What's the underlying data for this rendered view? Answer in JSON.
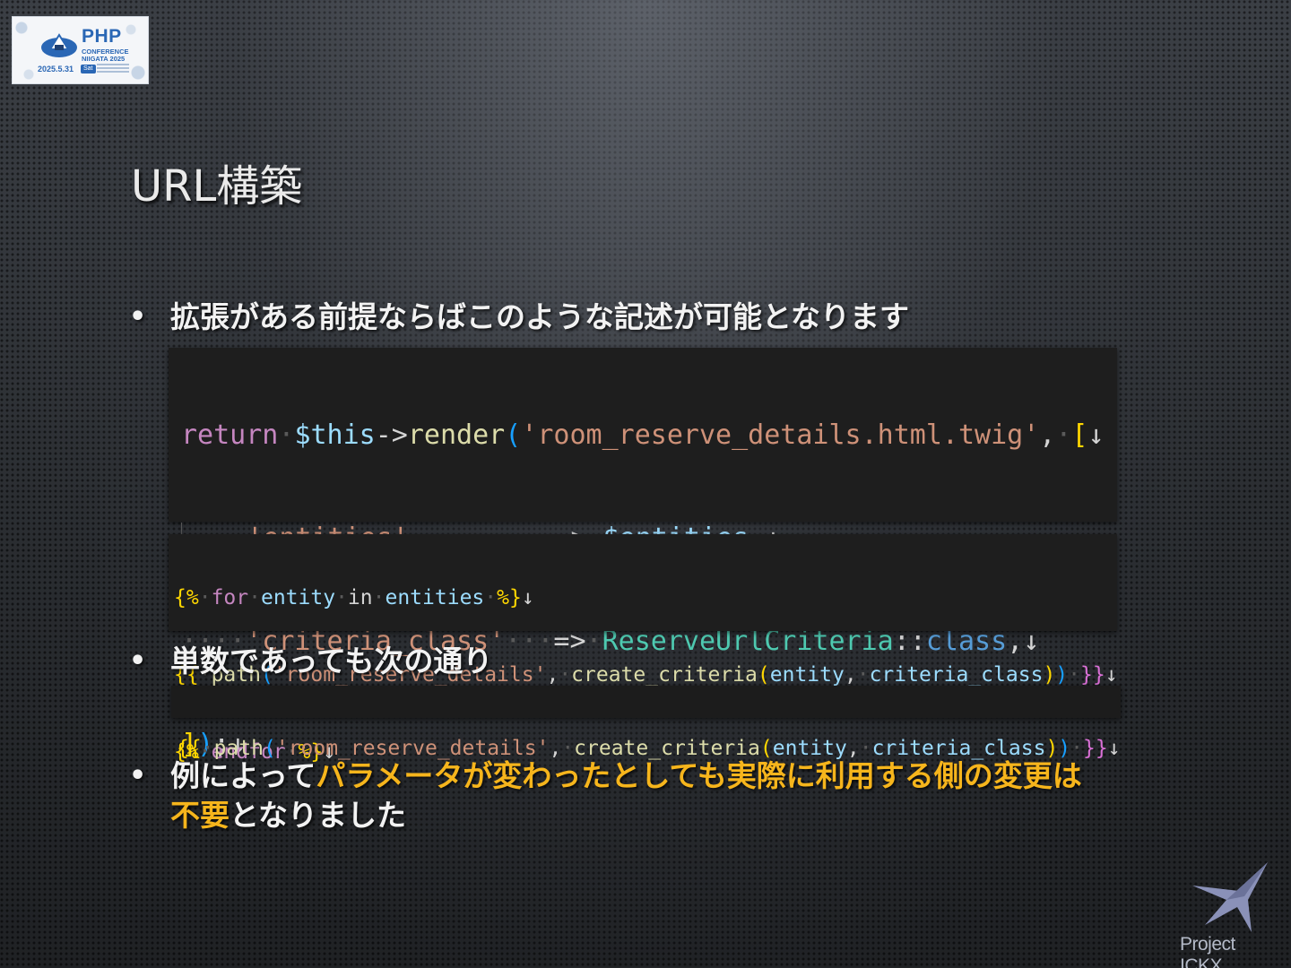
{
  "logo": {
    "name": "PHP",
    "subtitle_lines": [
      "CONFERENCE",
      "NIIGATA 2025"
    ],
    "date": "2025.5.31",
    "day": "Sat"
  },
  "slide": {
    "title": "URL構築",
    "bullets": [
      {
        "text": "拡張がある前提ならばこのような記述が可能となります"
      },
      {
        "text": "単数であっても次の通り"
      },
      {
        "plain_before": "例によって",
        "highlight_line1": "パラメータが変わったとしても実際に利用する側の変更は",
        "highlight_line2": "不要",
        "plain_after": "となりました"
      }
    ]
  },
  "code_php": {
    "l1": {
      "kw": "return",
      "var": "$this",
      "arrow": "->",
      "fn": "render",
      "p_open": "(",
      "str": "'room_reserve_details.html.twig'",
      "comma": ",",
      "b_open": "[",
      "eol": "↓"
    },
    "l2": {
      "dots1": "····",
      "key": "'entities'",
      "dots2": "·········",
      "op": "=>",
      "val": "$entities",
      "comma": ",",
      "eol": "↓"
    },
    "l3": {
      "dots1": "····",
      "key": "'criteria_class'",
      "dots2": "···",
      "op": "=>",
      "cls": "ReserveUrlCriteria",
      "dc": "::",
      "ckw": "class",
      "comma": ",",
      "eol": "↓"
    },
    "l4": {
      "b_close": "]",
      "p_close": ")",
      "semi": ";",
      "eol": "↓"
    }
  },
  "code_twig": {
    "l1": {
      "open": "{%",
      "kw_for": "for",
      "entity": "entity",
      "kw_in": "in",
      "entities": "entities",
      "close": "%}",
      "eol": "↓"
    },
    "l2": {
      "open": "{{",
      "fn": "path",
      "p1": "(",
      "str": "'room_reserve_details'",
      "comma1": ",",
      "fn2": "create_criteria",
      "p2": "(",
      "arg1": "entity",
      "comma2": ",",
      "arg2": "criteria_class",
      "p2c": ")",
      "p1c": ")",
      "close": "}}",
      "eol": "↓"
    },
    "l3": {
      "open": "{%",
      "kw": "endfor",
      "close": "%}",
      "eol": "↓"
    }
  },
  "code_single": {
    "l1": {
      "open": "{{",
      "fn": "path",
      "p1": "(",
      "str": "'room_reserve_details'",
      "comma1": ",",
      "fn2": "create_criteria",
      "p2": "(",
      "arg1": "entity",
      "comma2": ",",
      "arg2": "criteria_class",
      "p2c": ")",
      "p1c": ")",
      "close": "}}",
      "eol": "↓"
    }
  },
  "brand": {
    "name": "Project ICKX"
  },
  "colors": {
    "highlight": "#f6b51c",
    "code_background": "#1e1e1e",
    "keyword": "#c586c0",
    "variable": "#9cdcfe",
    "function": "#dcdcaa",
    "string": "#ce9178",
    "class": "#4ec9b0"
  },
  "icons": {
    "bullet": "bullet-dot-icon",
    "brand": "arrow-bird-logo-icon",
    "mascot": "onigiri-mascot-icon"
  }
}
